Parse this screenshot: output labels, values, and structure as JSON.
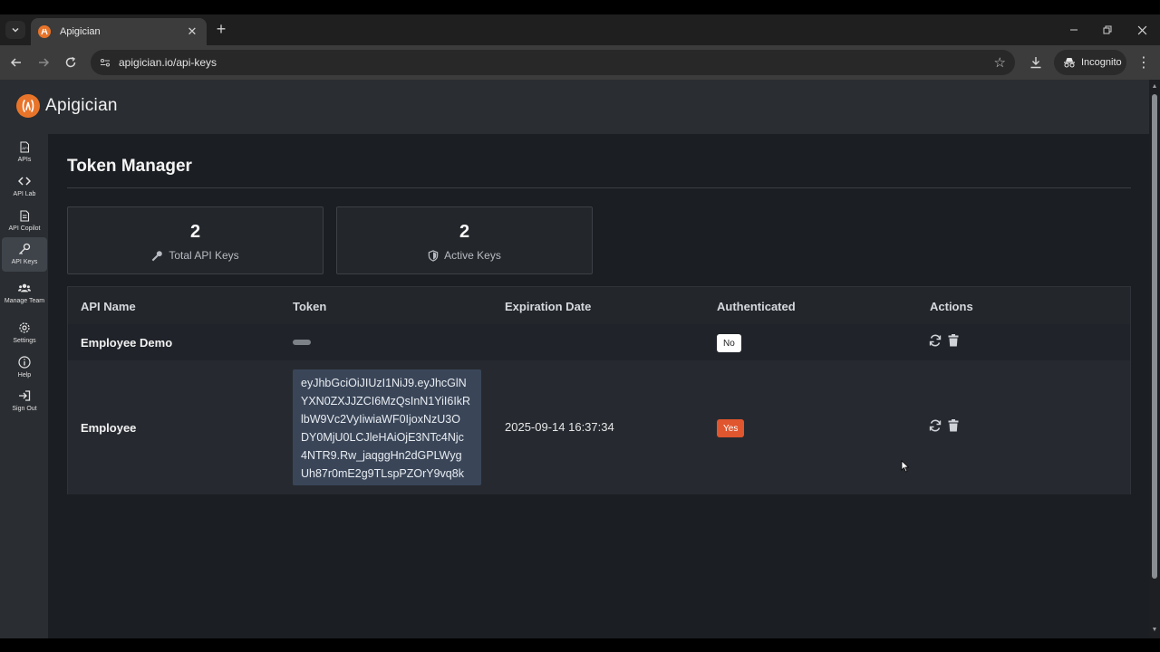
{
  "browser": {
    "tab_title": "Apigician",
    "url": "apigician.io/api-keys",
    "incognito_label": "Incognito"
  },
  "app": {
    "logo_text": "Apigician",
    "brand_color": "#e8742a"
  },
  "sidebar": {
    "items": [
      {
        "label": "APIs",
        "icon": "api-doc-icon"
      },
      {
        "label": "API Lab",
        "icon": "code-icon"
      },
      {
        "label": "API Copilot",
        "icon": "document-icon"
      },
      {
        "label": "API Keys",
        "icon": "key-icon",
        "active": true
      },
      {
        "label": "Manage Team",
        "icon": "users-icon"
      },
      {
        "label": "Settings",
        "icon": "gear-icon"
      },
      {
        "label": "Help",
        "icon": "info-icon"
      },
      {
        "label": "Sign Out",
        "icon": "sign-out-icon"
      }
    ]
  },
  "page": {
    "title": "Token Manager"
  },
  "stats": [
    {
      "value": "2",
      "label": "Total API Keys",
      "icon": "key-icon"
    },
    {
      "value": "2",
      "label": "Active Keys",
      "icon": "shield-icon"
    }
  ],
  "table": {
    "headers": [
      "API Name",
      "Token",
      "Expiration Date",
      "Authenticated",
      "Actions"
    ],
    "rows": [
      {
        "name": "Employee Demo",
        "token_lines": [],
        "expiration": "",
        "authenticated": "No"
      },
      {
        "name": "Employee",
        "token_lines": [
          "eyJhbGciOiJIUzI1NiJ9.eyJhcGlN",
          "YXN0ZXJJZCI6MzQsInN1YiI6IkR",
          "lbW9Vc2VyIiwiaWF0IjoxNzU3O",
          "DY0MjU0LCJleHAiOjE3NTc4Njc",
          "4NTR9.Rw_jaqggHn2dGPLWyg",
          "Uh87r0mE2g9TLspPZOrY9vq8k"
        ],
        "expiration": "2025-09-14 16:37:34",
        "authenticated": "Yes"
      }
    ]
  },
  "colors": {
    "yes_badge": "#e0562f",
    "no_badge": "#ffffff",
    "token_bg": "#3a4658"
  }
}
